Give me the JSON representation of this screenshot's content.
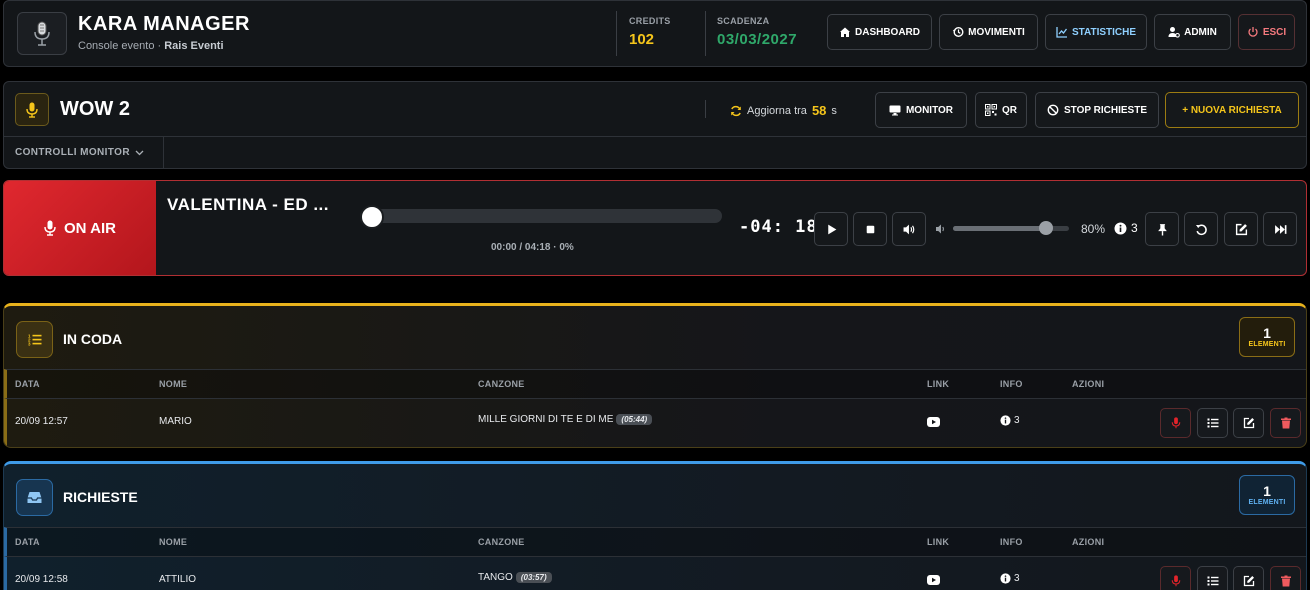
{
  "header": {
    "title": "KARA MANAGER",
    "subtitle_prefix": "Console evento · ",
    "subtitle_org": "Rais Eventi",
    "credits_label": "CREDITS",
    "credits_value": "102",
    "scadenza_label": "SCADENZA",
    "scadenza_value": "03/03/2027",
    "nav": {
      "dashboard": "DASHBOARD",
      "movimenti": "MOVIMENTI",
      "statistiche": "STATISTICHE",
      "admin": "ADMIN",
      "esci": "ESCI"
    }
  },
  "event": {
    "title": "WOW 2",
    "refresh_label": "Aggiorna tra",
    "refresh_seconds": "58",
    "refresh_unit": "s",
    "controls_label": "CONTROLLI MONITOR",
    "buttons": {
      "monitor": "MONITOR",
      "qr": "QR",
      "stop": "STOP RICHIESTE",
      "new": "+ NUOVA RICHIESTA"
    }
  },
  "player": {
    "on_air_label": "ON AIR",
    "song": "VALENTINA - ED ...",
    "progress_fraction": 0,
    "time_text": "00:00 / 04:18 · 0%",
    "countdown": "-04: 18",
    "volume_fraction": 0.8,
    "volume_text": "80%",
    "info_count": "3"
  },
  "queue": {
    "title": "IN CODA",
    "count": "1",
    "count_label": "ELEMENTI",
    "columns": {
      "data": "DATA",
      "nome": "NOME",
      "canzone": "CANZONE",
      "link": "LINK",
      "info": "INFO",
      "azioni": "AZIONI"
    },
    "rows": [
      {
        "data": "20/09 12:57",
        "nome": "MARIO",
        "canzone": "MILLE GIORNI DI TE E DI ME",
        "durata": "(05:44)",
        "info": "3"
      }
    ]
  },
  "requests": {
    "title": "RICHIESTE",
    "count": "1",
    "count_label": "ELEMENTI",
    "columns": {
      "data": "DATA",
      "nome": "NOME",
      "canzone": "CANZONE",
      "link": "LINK",
      "info": "INFO",
      "azioni": "AZIONI"
    },
    "rows": [
      {
        "data": "20/09 12:58",
        "nome": "ATTILIO",
        "canzone": "TANGO",
        "durata": "(03:57)",
        "info": "3"
      }
    ]
  },
  "colors": {
    "accent_yellow": "#f5c51b",
    "accent_green": "#2fa86a",
    "accent_blue": "#3f9be8",
    "on_air_red": "#e0282f",
    "delete_red": "#f05a5e"
  }
}
